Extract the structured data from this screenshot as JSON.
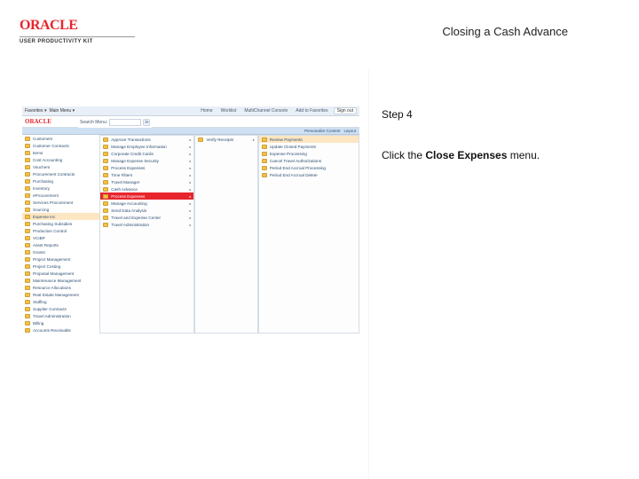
{
  "brand": {
    "logo": "ORACLE",
    "sub": "USER PRODUCTIVITY KIT"
  },
  "doc_title": "Closing a Cash Advance",
  "step": {
    "label": "Step 4",
    "text_pre": "Click the ",
    "bold": "Close Expenses",
    "text_post": " menu."
  },
  "app": {
    "topbar": {
      "favorites": "Favorites ▾",
      "mainmenu": "Main Menu ▾",
      "links": [
        "Home",
        "Worklist",
        "MultiChannel Console",
        "Add to Favorites"
      ],
      "signout": "Sign out"
    },
    "search": {
      "label": "Search Menu:",
      "placeholder": "",
      "go_icon": "go-icon"
    },
    "bluebar": {
      "personalize": "Personalize Content",
      "layout": "Layout"
    },
    "col1": [
      "Customers",
      "Customer Contracts",
      "Items",
      "Cost Accounting",
      "Vouchers",
      "Procurement Contracts",
      "Purchasing",
      "Inventory",
      "eProcurement",
      "Services Procurement",
      "Sourcing",
      "Expense Inc",
      "Purchasing Subsidies",
      "Production Control",
      "VCIBP",
      "Asset Reports",
      "Grants",
      "Project Management",
      "Project Costing",
      "Proposal Management",
      "Maintenance Management",
      "Resource Allocations",
      "Real Estate Management",
      "Staffing",
      "Supplier Contracts",
      "Travel Administration",
      "Billing",
      "Accounts Receivable"
    ],
    "col1_selected_index": 11,
    "col2": [
      "Approve Transactions",
      "Manage Employee Information",
      "Corporate Credit Cards",
      "Manage Expense Security",
      "Process Expenses",
      "Time Filters",
      "Travel Manager",
      "Cash Advance",
      "Process Expenses",
      "Manage Accounting",
      "Send Data Analysis",
      "Travel and Expense Center",
      "Travel Administration"
    ],
    "col2_highlight_index": 8,
    "col3": [
      "Verify Receipts"
    ],
    "col4": [
      "Review Payments",
      "Update Closed Payments",
      "Expense Processing",
      "Cancel Travel Authorizations",
      "Period End Accrual Processing",
      "Period End Accrual Delete"
    ],
    "col4_highlight_index": 0
  }
}
